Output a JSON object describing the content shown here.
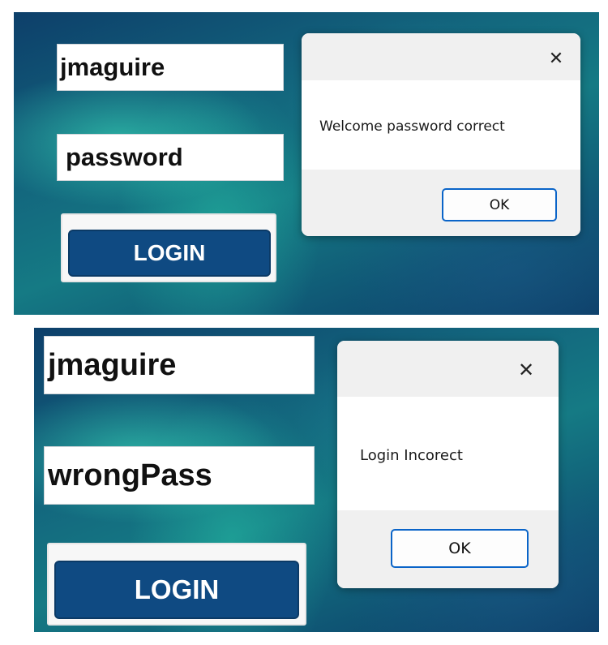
{
  "screens": [
    {
      "username_value": "jmaguire",
      "password_value": "password",
      "login_label": "LOGIN",
      "dialog": {
        "close_glyph": "✕",
        "message": "Welcome password correct",
        "ok_label": "OK"
      }
    },
    {
      "username_value": "jmaguire",
      "password_value": "wrongPass",
      "login_label": "LOGIN",
      "dialog": {
        "close_glyph": "✕",
        "message": "Login Incorect",
        "ok_label": "OK"
      }
    }
  ],
  "colors": {
    "login_button": "#0f4a82",
    "dialog_ok_border": "#0a64c8",
    "dialog_bar": "#f0f0f0"
  },
  "icons": [
    "close-icon"
  ]
}
